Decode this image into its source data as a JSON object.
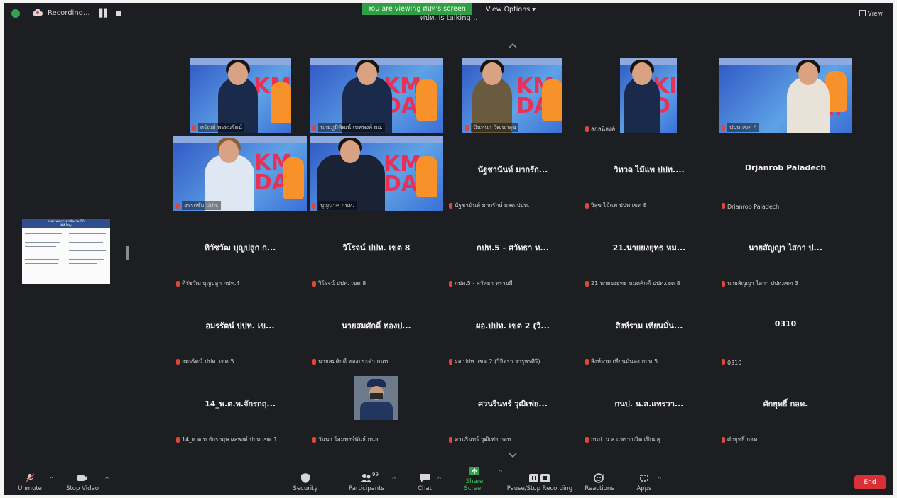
{
  "top_bar": {
    "recording_label": "Recording...",
    "share_banner": "You are viewing ศปท's screen",
    "sharer_name": "ศปท. is talking...",
    "view_options_label": "View Options",
    "view_label": "View"
  },
  "video_tiles": [
    {
      "label": "ศรัณย์ พรหมรัตน์"
    },
    {
      "label": "นายภูมิพัฒน์ เทพพงศ์ ผอ."
    },
    {
      "label": "นันทนา วัฒนาสุข"
    },
    {
      "label": "สกุลนิลงค์"
    },
    {
      "label": "ปปท.เขต 4"
    },
    {
      "label": "อรรถชัย ปปท."
    },
    {
      "label": "บุญนาค กนท."
    }
  ],
  "name_tiles": [
    {
      "display": "นัฐชานันท์ มากรัก...",
      "label": "นัฐชานันท์ มากรักษ์ ผลต.ปปท."
    },
    {
      "display": "วิทวด ไม้แพ ปปท....",
      "label": "วิสุข ไม้แพ ปปท.เขต 8"
    },
    {
      "display": "Drjanrob Paladech",
      "label": "Drjanrob Paladech"
    },
    {
      "display": "ทิวัชวัฒ บุญปลูก ก...",
      "label": "ดิวัชวัฒ บุญปลูก กปท.4"
    },
    {
      "display": "วิโรจน์ ปปท. เขต 8",
      "label": "วิโรจน์ ปปท. เขต 8"
    },
    {
      "display": "กปท.5 - ศวัทธา ท...",
      "label": "กปท.5 - ศวัทธา ทรายมี"
    },
    {
      "display": "21.นายยงยุทธ หม...",
      "label": "21.นายยงยุทธ หมดศักดิ์ ปปท.เขต 8"
    },
    {
      "display": "นายสัญญา ไสกา ป...",
      "label": "นายสัญญา ไสกา ปปท.เขต 3"
    },
    {
      "display": "อมรรัตน์ ปปท. เข...",
      "label": "อมรรัตน์ ปปท. เขต 5"
    },
    {
      "display": "นายสมศักดิ์ ทองป...",
      "label": "นายสมศักดิ์ ทองประคำ กนท."
    },
    {
      "display": "ผอ.ปปท. เขต 2 (วิ...",
      "label": "ผอ.ปปท. เขต 2 (วิจิตรา จารุพรศิริ)"
    },
    {
      "display": "สิงห์ราม เทียนมั่น...",
      "label": "สิงห์ราม เทียนมั่นคง กปท.5"
    },
    {
      "display": "0310",
      "label": "0310"
    },
    {
      "display": "14_พ.ต.ท.จักรกฤ...",
      "label": "14_พ.ต.ท.จักรกฤษ ผลพงศ์ ปปท.เขต 1"
    },
    {
      "display": "",
      "label": "วันนา โสมพงษ์พันธ์ กนอ."
    },
    {
      "display": "ศวนรินทร์ วุฒิเฟย...",
      "label": "ศวนรินทร์ วุฒิเฟย กอท."
    },
    {
      "display": "กนป. น.ส.แพรวา...",
      "label": "กนป. น.ส.แพรวาณิต เปี่ยมสุ"
    },
    {
      "display": "ศักยุทธิ์ กอท.",
      "label": "ศักยุทธิ์ กอท."
    }
  ],
  "share_thumbnail": {
    "title": "รายงานผลการดำเนินงาน ITA",
    "subtitle": "KM Day"
  },
  "toolbar": {
    "unmute": "Unmute",
    "stop_video": "Stop Video",
    "security": "Security",
    "participants": "Participants",
    "participants_count": "99",
    "chat": "Chat",
    "share_screen": "Share Screen",
    "pause_stop_recording": "Pause/Stop Recording",
    "reactions": "Reactions",
    "apps": "Apps",
    "end": "End"
  },
  "colors": {
    "background": "#1d1e21",
    "share_green": "#2f9e44",
    "mic_muted": "#e0463a",
    "end_red": "#d93038"
  }
}
